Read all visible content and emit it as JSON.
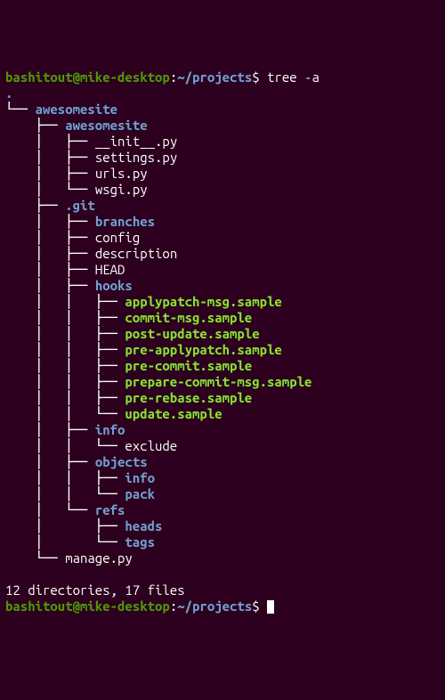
{
  "prompt": {
    "user": "bashitout@mike-desktop",
    "sep1": ":",
    "path": "~/projects",
    "sep2": "$",
    "cmd": "tree -a"
  },
  "root": ".",
  "tree": [
    {
      "prefix": "└── ",
      "name": "awesomesite",
      "cls": "blue"
    },
    {
      "prefix": "    ├── ",
      "name": "awesomesite",
      "cls": "blue"
    },
    {
      "prefix": "    │   ├── ",
      "name": "__init__.py",
      "cls": "white"
    },
    {
      "prefix": "    │   ├── ",
      "name": "settings.py",
      "cls": "white"
    },
    {
      "prefix": "    │   ├── ",
      "name": "urls.py",
      "cls": "white"
    },
    {
      "prefix": "    │   └── ",
      "name": "wsgi.py",
      "cls": "white"
    },
    {
      "prefix": "    ├── ",
      "name": ".git",
      "cls": "blue"
    },
    {
      "prefix": "    │   ├── ",
      "name": "branches",
      "cls": "blue"
    },
    {
      "prefix": "    │   ├── ",
      "name": "config",
      "cls": "white"
    },
    {
      "prefix": "    │   ├── ",
      "name": "description",
      "cls": "white"
    },
    {
      "prefix": "    │   ├── ",
      "name": "HEAD",
      "cls": "white"
    },
    {
      "prefix": "    │   ├── ",
      "name": "hooks",
      "cls": "blue"
    },
    {
      "prefix": "    │   │   ├── ",
      "name": "applypatch-msg.sample",
      "cls": "bgreen"
    },
    {
      "prefix": "    │   │   ├── ",
      "name": "commit-msg.sample",
      "cls": "bgreen"
    },
    {
      "prefix": "    │   │   ├── ",
      "name": "post-update.sample",
      "cls": "bgreen"
    },
    {
      "prefix": "    │   │   ├── ",
      "name": "pre-applypatch.sample",
      "cls": "bgreen"
    },
    {
      "prefix": "    │   │   ├── ",
      "name": "pre-commit.sample",
      "cls": "bgreen"
    },
    {
      "prefix": "    │   │   ├── ",
      "name": "prepare-commit-msg.sample",
      "cls": "bgreen"
    },
    {
      "prefix": "    │   │   ├── ",
      "name": "pre-rebase.sample",
      "cls": "bgreen"
    },
    {
      "prefix": "    │   │   └── ",
      "name": "update.sample",
      "cls": "bgreen"
    },
    {
      "prefix": "    │   ├── ",
      "name": "info",
      "cls": "blue"
    },
    {
      "prefix": "    │   │   └── ",
      "name": "exclude",
      "cls": "white"
    },
    {
      "prefix": "    │   ├── ",
      "name": "objects",
      "cls": "blue"
    },
    {
      "prefix": "    │   │   ├── ",
      "name": "info",
      "cls": "blue"
    },
    {
      "prefix": "    │   │   └── ",
      "name": "pack",
      "cls": "blue"
    },
    {
      "prefix": "    │   └── ",
      "name": "refs",
      "cls": "blue"
    },
    {
      "prefix": "    │       ├── ",
      "name": "heads",
      "cls": "blue"
    },
    {
      "prefix": "    │       └── ",
      "name": "tags",
      "cls": "blue"
    },
    {
      "prefix": "    └── ",
      "name": "manage.py",
      "cls": "white"
    }
  ],
  "summary": "12 directories, 17 files"
}
